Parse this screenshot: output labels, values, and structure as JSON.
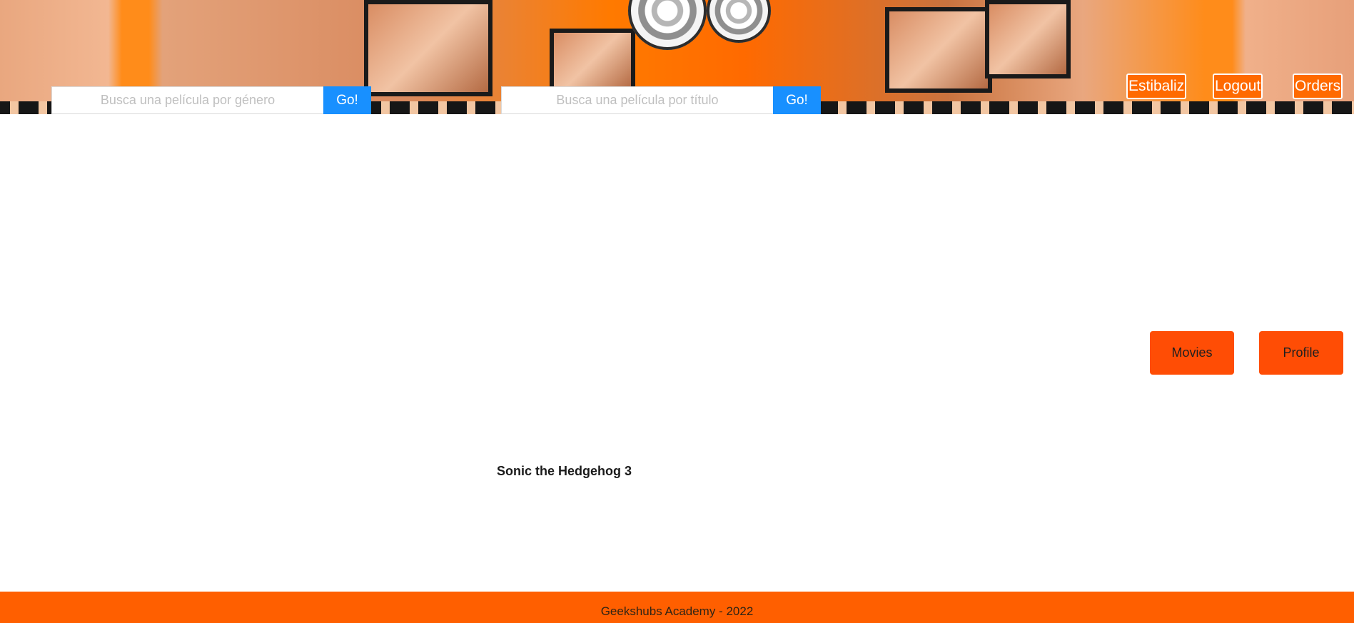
{
  "header": {
    "banner_icon": "film-reel-banner",
    "search_genre": {
      "placeholder": "Busca una película por género",
      "button_label": "Go!"
    },
    "search_title": {
      "placeholder": "Busca una película por título",
      "button_label": "Go!"
    },
    "nav": {
      "user_label": "Estibaliz",
      "logout_label": "Logout",
      "orders_label": "Orders"
    }
  },
  "main": {
    "movie_title": "Sonic the Hedgehog 3",
    "side_buttons": {
      "movies_label": "Movies",
      "profile_label": "Profile"
    }
  },
  "footer": {
    "text": "Geekshubs Academy - 2022"
  },
  "colors": {
    "accent_orange": "#ff5f00",
    "button_orange": "#ff4d05",
    "go_blue": "#1890ff"
  }
}
